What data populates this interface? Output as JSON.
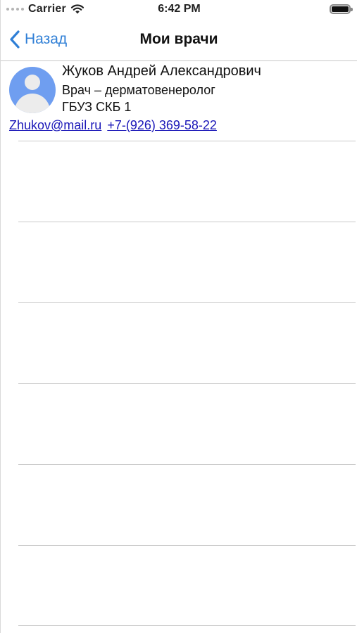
{
  "status_bar": {
    "carrier": "Carrier",
    "time": "6:42 PM",
    "icons": [
      "signal-dots-icon",
      "wifi-icon",
      "battery-icon"
    ]
  },
  "nav": {
    "back_label": "Назад",
    "title": "Мои врачи"
  },
  "doctor": {
    "name": "Жуков Андрей Александрович",
    "specialty": "Врач – дерматовенеролог",
    "organization": "ГБУЗ СКБ 1",
    "email": "Zhukov@mail.ru",
    "phone": "+7-(926) 369-58-22",
    "avatar_icon": "person-avatar-icon"
  },
  "colors": {
    "accent": "#2f7fd6",
    "link": "#1a17b8",
    "avatar_bg": "#6f9ef0",
    "separator": "#c9c9c9"
  }
}
